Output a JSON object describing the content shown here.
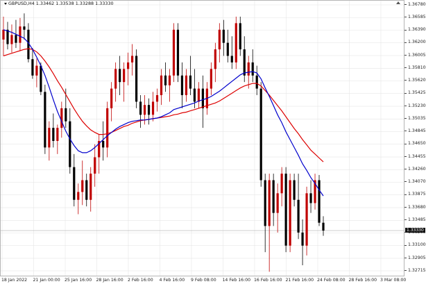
{
  "window": {
    "symbol_title": "GBPUSD,H4  1.33462 1.33538 1.33288 1.33330",
    "current_price": "1.33330"
  },
  "price_axis": {
    "labels": [
      "1.36780",
      "1.36585",
      "1.36390",
      "1.36200",
      "1.36005",
      "1.35810",
      "1.35620",
      "1.35425",
      "1.35230",
      "1.35035",
      "1.34845",
      "1.34650",
      "1.34455",
      "1.34260",
      "1.34070",
      "1.33875",
      "1.33680",
      "1.33485",
      "1.33295",
      "1.33100",
      "1.32905",
      "1.32715"
    ]
  },
  "time_axis": {
    "labels": [
      "18 Jan 2022",
      "21 Jan 00:00",
      "25 Jan 16:00",
      "28 Jan 16:00",
      "2 Feb 16:00",
      "4 Feb 16:00",
      "9 Feb 08:00",
      "14 Feb 16:00",
      "16 Feb 16:00",
      "21 Feb 16:00",
      "24 Feb 08:00",
      "28 Feb 16:00",
      "3 Mar 08:00"
    ]
  },
  "colors": {
    "bull": "#c00000",
    "bear": "#000000",
    "ma_fast": "#0000cc",
    "ma_slow": "#dd0000",
    "grid": "#e6e6e6",
    "current_price_line": "#b0b0b0"
  },
  "chart_data": {
    "type": "candlestick",
    "symbol": "GBPUSD",
    "timeframe": "H4",
    "ohlc_header": {
      "open": 1.33462,
      "high": 1.33538,
      "low": 1.33288,
      "close": 1.3333
    },
    "ylim": [
      1.3262,
      1.3688
    ],
    "grid": true,
    "candles": [
      [
        1.3625,
        1.366,
        1.36,
        1.364
      ],
      [
        1.364,
        1.3652,
        1.361,
        1.3618
      ],
      [
        1.3618,
        1.3648,
        1.3605,
        1.3632
      ],
      [
        1.3632,
        1.3655,
        1.3612,
        1.362
      ],
      [
        1.362,
        1.3658,
        1.3608,
        1.3645
      ],
      [
        1.3645,
        1.3665,
        1.3625,
        1.364
      ],
      [
        1.364,
        1.365,
        1.359,
        1.3595
      ],
      [
        1.3595,
        1.3612,
        1.3565,
        1.357
      ],
      [
        1.357,
        1.3596,
        1.3552,
        1.3585
      ],
      [
        1.3585,
        1.359,
        1.354,
        1.3545
      ],
      [
        1.3545,
        1.3556,
        1.345,
        1.346
      ],
      [
        1.346,
        1.35,
        1.344,
        1.349
      ],
      [
        1.349,
        1.3512,
        1.346,
        1.347
      ],
      [
        1.347,
        1.3495,
        1.345,
        1.349
      ],
      [
        1.349,
        1.353,
        1.3475,
        1.352
      ],
      [
        1.352,
        1.355,
        1.349,
        1.35
      ],
      [
        1.35,
        1.352,
        1.342,
        1.343
      ],
      [
        1.343,
        1.345,
        1.337,
        1.338
      ],
      [
        1.338,
        1.3405,
        1.3358,
        1.3392
      ],
      [
        1.3392,
        1.344,
        1.3372,
        1.341
      ],
      [
        1.341,
        1.342,
        1.337,
        1.338
      ],
      [
        1.338,
        1.343,
        1.3362,
        1.342
      ],
      [
        1.342,
        1.3465,
        1.34,
        1.3445
      ],
      [
        1.3445,
        1.348,
        1.342,
        1.347
      ],
      [
        1.347,
        1.35,
        1.344,
        1.346
      ],
      [
        1.346,
        1.353,
        1.3445,
        1.352
      ],
      [
        1.352,
        1.356,
        1.35,
        1.355
      ],
      [
        1.355,
        1.359,
        1.353,
        1.358
      ],
      [
        1.358,
        1.36,
        1.354,
        1.356
      ],
      [
        1.356,
        1.359,
        1.353,
        1.358
      ],
      [
        1.358,
        1.3605,
        1.3555,
        1.359
      ],
      [
        1.359,
        1.3618,
        1.357,
        1.36
      ],
      [
        1.36,
        1.361,
        1.352,
        1.353
      ],
      [
        1.353,
        1.354,
        1.349,
        1.351
      ],
      [
        1.351,
        1.354,
        1.3495,
        1.3525
      ],
      [
        1.3525,
        1.3535,
        1.3495,
        1.351
      ],
      [
        1.351,
        1.3545,
        1.35,
        1.353
      ],
      [
        1.353,
        1.355,
        1.3515,
        1.354
      ],
      [
        1.354,
        1.358,
        1.3525,
        1.357
      ],
      [
        1.357,
        1.359,
        1.3545,
        1.3555
      ],
      [
        1.3555,
        1.358,
        1.353,
        1.357
      ],
      [
        1.357,
        1.365,
        1.356,
        1.364
      ],
      [
        1.364,
        1.365,
        1.356,
        1.357
      ],
      [
        1.357,
        1.359,
        1.352,
        1.354
      ],
      [
        1.354,
        1.358,
        1.353,
        1.357
      ],
      [
        1.357,
        1.36,
        1.354,
        1.355
      ],
      [
        1.355,
        1.358,
        1.352,
        1.353
      ],
      [
        1.353,
        1.356,
        1.352,
        1.355
      ],
      [
        1.355,
        1.357,
        1.349,
        1.352
      ],
      [
        1.352,
        1.356,
        1.351,
        1.355
      ],
      [
        1.355,
        1.359,
        1.354,
        1.358
      ],
      [
        1.358,
        1.362,
        1.356,
        1.361
      ],
      [
        1.361,
        1.365,
        1.359,
        1.364
      ],
      [
        1.364,
        1.3655,
        1.36,
        1.362
      ],
      [
        1.362,
        1.364,
        1.359,
        1.36
      ],
      [
        1.36,
        1.363,
        1.358,
        1.359
      ],
      [
        1.359,
        1.366,
        1.358,
        1.365
      ],
      [
        1.365,
        1.366,
        1.36,
        1.361
      ],
      [
        1.361,
        1.363,
        1.356,
        1.357
      ],
      [
        1.357,
        1.36,
        1.355,
        1.359
      ],
      [
        1.359,
        1.361,
        1.356,
        1.357
      ],
      [
        1.357,
        1.3585,
        1.354,
        1.355
      ],
      [
        1.355,
        1.356,
        1.34,
        1.341
      ],
      [
        1.341,
        1.342,
        1.33,
        1.334
      ],
      [
        1.334,
        1.342,
        1.327,
        1.341
      ],
      [
        1.341,
        1.342,
        1.334,
        1.336
      ],
      [
        1.336,
        1.3405,
        1.333,
        1.339
      ],
      [
        1.339,
        1.343,
        1.337,
        1.342
      ],
      [
        1.342,
        1.343,
        1.33,
        1.331
      ],
      [
        1.331,
        1.342,
        1.33,
        1.341
      ],
      [
        1.341,
        1.342,
        1.337,
        1.338
      ],
      [
        1.338,
        1.342,
        1.332,
        1.333
      ],
      [
        1.333,
        1.335,
        1.328,
        1.331
      ],
      [
        1.331,
        1.34,
        1.3295,
        1.339
      ],
      [
        1.339,
        1.341,
        1.336,
        1.3375
      ],
      [
        1.3375,
        1.342,
        1.3365,
        1.341
      ],
      [
        1.341,
        1.3418,
        1.334,
        1.3345
      ],
      [
        1.3345,
        1.3355,
        1.3325,
        1.3333
      ]
    ],
    "ma_fast": [
      1.364,
      1.3638,
      1.3636,
      1.3633,
      1.363,
      1.3627,
      1.362,
      1.361,
      1.3598,
      1.3585,
      1.357,
      1.3552,
      1.3533,
      1.3515,
      1.35,
      1.3485,
      1.3473,
      1.3463,
      1.3455,
      1.3452,
      1.3452,
      1.3455,
      1.346,
      1.3466,
      1.3472,
      1.3478,
      1.3483,
      1.3488,
      1.3492,
      1.3495,
      1.3498,
      1.35,
      1.3501,
      1.3502,
      1.3502,
      1.3503,
      1.3504,
      1.3505,
      1.3507,
      1.351,
      1.3513,
      1.3518,
      1.352,
      1.3522,
      1.3524,
      1.3526,
      1.3528,
      1.3531,
      1.3533,
      1.3535,
      1.3538,
      1.3542,
      1.3546,
      1.3551,
      1.3556,
      1.3561,
      1.3566,
      1.3571,
      1.3574,
      1.3575,
      1.3576,
      1.3574,
      1.3565,
      1.3551,
      1.3538,
      1.3524,
      1.351,
      1.3498,
      1.3484,
      1.3472,
      1.346,
      1.3448,
      1.3435,
      1.3425,
      1.3414,
      1.3405,
      1.3395,
      1.3386
    ],
    "ma_slow": [
      1.36,
      1.3602,
      1.3604,
      1.3606,
      1.3608,
      1.361,
      1.3611,
      1.361,
      1.3606,
      1.36,
      1.3592,
      1.3583,
      1.3573,
      1.3562,
      1.3552,
      1.3541,
      1.353,
      1.3519,
      1.3509,
      1.35,
      1.3493,
      1.3487,
      1.3483,
      1.348,
      1.348,
      1.3481,
      1.3483,
      1.3486,
      1.3489,
      1.3492,
      1.3494,
      1.3497,
      1.3499,
      1.3501,
      1.3502,
      1.3503,
      1.3504,
      1.3505,
      1.3506,
      1.3507,
      1.3508,
      1.351,
      1.3511,
      1.3513,
      1.3514,
      1.3516,
      1.3518,
      1.352,
      1.3522,
      1.3524,
      1.3526,
      1.3528,
      1.3531,
      1.3535,
      1.3539,
      1.3543,
      1.3547,
      1.3551,
      1.3554,
      1.3556,
      1.3558,
      1.3558,
      1.3554,
      1.3547,
      1.354,
      1.3532,
      1.3524,
      1.3516,
      1.3507,
      1.3498,
      1.3489,
      1.3481,
      1.3472,
      1.3464,
      1.3456,
      1.345,
      1.3444,
      1.3438
    ]
  }
}
